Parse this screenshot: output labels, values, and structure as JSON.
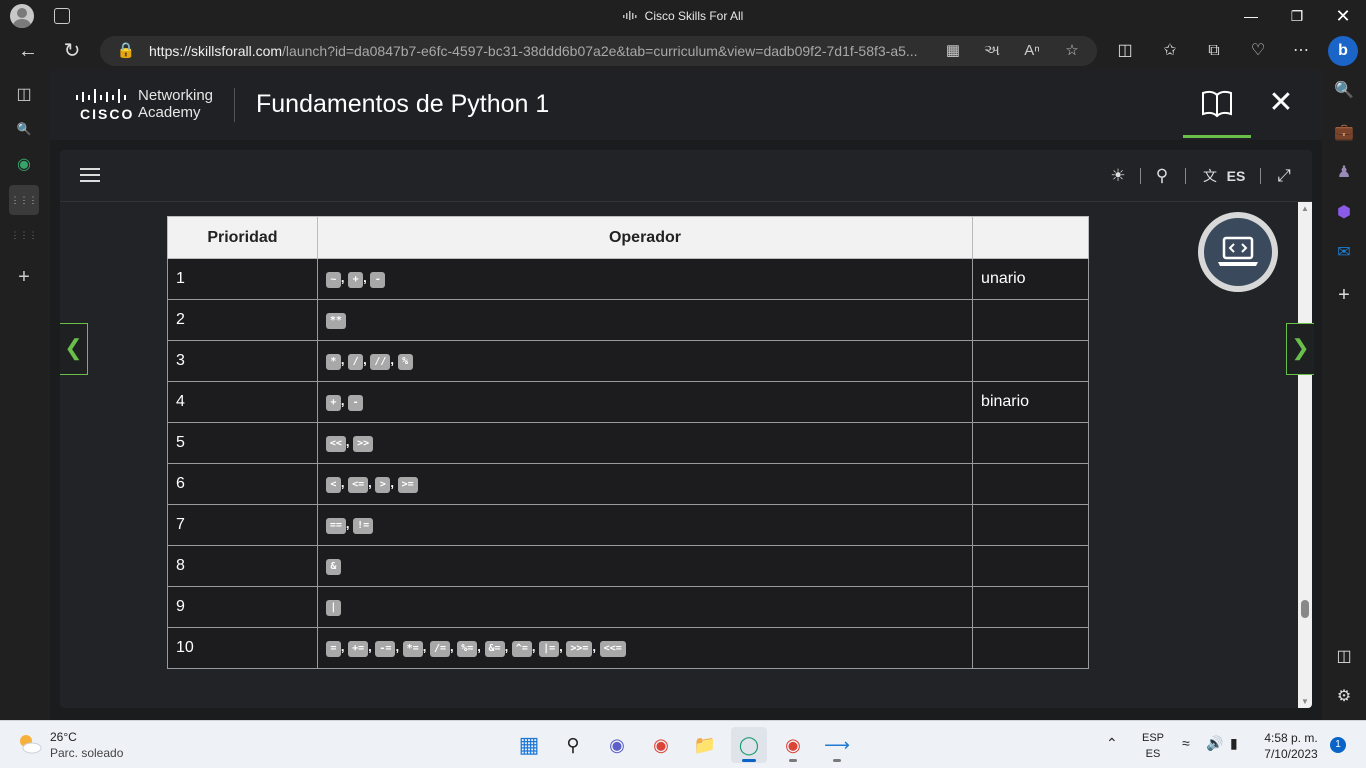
{
  "browser": {
    "window_title": "Cisco Skills For All",
    "url_domain": "https://skillsforall.com",
    "url_rest": "/launch?id=da0847b7-e6fc-4597-bc31-38ddd6b07a2e&tab=curriculum&view=dadb09f2-7d1f-58f3-a5..."
  },
  "header": {
    "logo_word": "CISCO",
    "logo_line1": "Networking",
    "logo_line2": "Academy",
    "course_title": "Fundamentos de Python 1"
  },
  "toolbar": {
    "language_code": "ES"
  },
  "table": {
    "headers": [
      "Prioridad",
      "Operador",
      ""
    ],
    "rows": [
      {
        "priority": "1",
        "ops": [
          "~",
          "+",
          "-"
        ],
        "note": "unario"
      },
      {
        "priority": "2",
        "ops": [
          "**"
        ],
        "note": ""
      },
      {
        "priority": "3",
        "ops": [
          "*",
          "/",
          "//",
          "%"
        ],
        "note": ""
      },
      {
        "priority": "4",
        "ops": [
          "+",
          "-"
        ],
        "note": "binario"
      },
      {
        "priority": "5",
        "ops": [
          "<<",
          ">>"
        ],
        "note": ""
      },
      {
        "priority": "6",
        "ops": [
          "<",
          "<=",
          ">",
          ">="
        ],
        "note": ""
      },
      {
        "priority": "7",
        "ops": [
          "==",
          "!="
        ],
        "note": ""
      },
      {
        "priority": "8",
        "ops": [
          "&"
        ],
        "note": ""
      },
      {
        "priority": "9",
        "ops": [
          "|"
        ],
        "note": ""
      },
      {
        "priority": "10",
        "ops": [
          "=",
          "+=",
          "-=",
          "*=",
          "/=",
          "%=",
          "&=",
          "^=",
          "|=",
          ">>=",
          "<<="
        ],
        "note": ""
      }
    ]
  },
  "taskbar": {
    "temperature": "26°C",
    "weather": "Parc. soleado",
    "lang_line1": "ESP",
    "lang_line2": "ES",
    "time": "4:58 p. m.",
    "date": "7/10/2023",
    "notifications": "1"
  },
  "colors": {
    "accent_green": "#6abf4b",
    "header_bg": "#202124",
    "panel_bg": "#222326",
    "op_badge": "#a8a8a8"
  }
}
